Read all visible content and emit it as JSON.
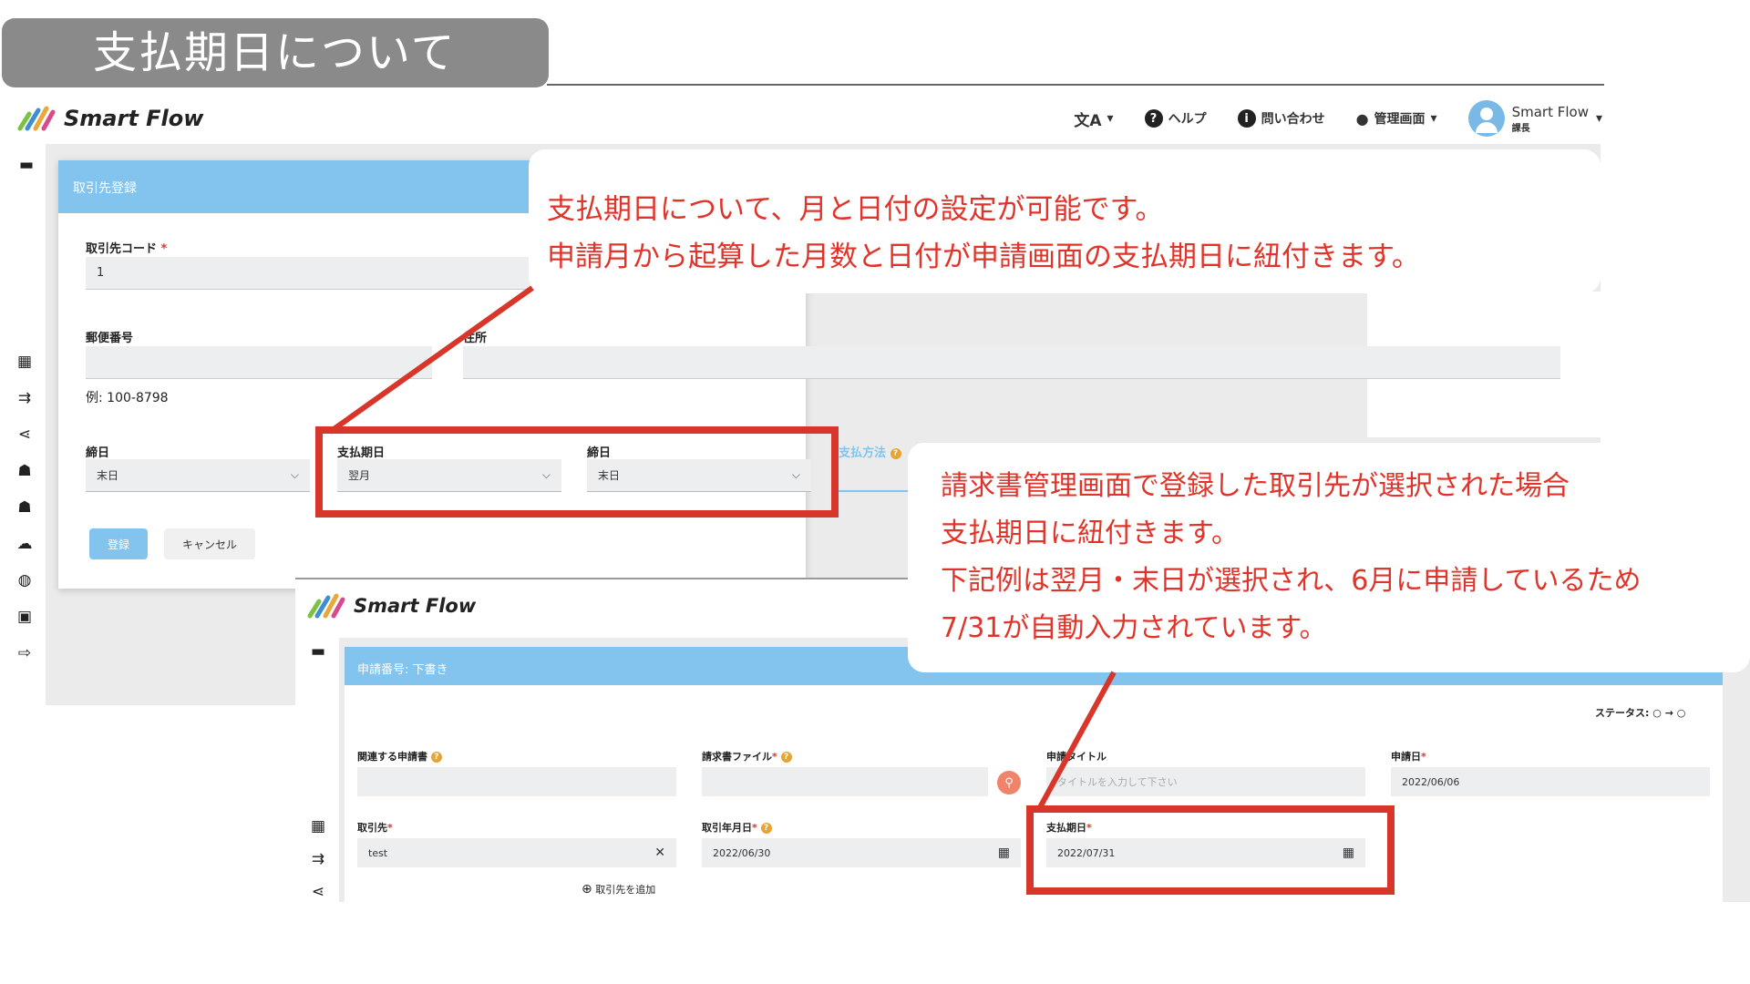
{
  "slide": {
    "title": "支払期日について"
  },
  "app": {
    "logo_text": "Smart Flow",
    "nav": {
      "translate": "文A",
      "help": "ヘルプ",
      "contact": "問い合わせ",
      "admin": "管理画面"
    },
    "user": {
      "name": "Smart Flow",
      "role": "課長"
    }
  },
  "form1": {
    "header": "取引先登録",
    "code_label": "取引先コード",
    "required_mark": "*",
    "code_value": "1",
    "postal_label": "郵便番号",
    "postal_hint": "例: 100-8798",
    "address_label": "住所",
    "closing_label": "締日",
    "closing_value": "末日",
    "pay_due_label": "支払期日",
    "pay_due_month": "翌月",
    "pay_due_day_label": "締日",
    "pay_due_day_value": "末日",
    "pay_method_label": "支払方法",
    "register_button": "登録",
    "cancel_button": "キャンセル"
  },
  "callout1": {
    "line1": "支払期日について、月と日付の設定が可能です。",
    "line2": "申請月から起算した月数と日付が申請画面の支払期日に紐付きます。"
  },
  "callout2": {
    "line1": "請求書管理画面で登録した取引先が選択された場合",
    "line2": "支払期日に紐付きます。",
    "line3": "下記例は翌月・末日が選択され、6月に申請しているため",
    "line4": "7/31が自動入力されています。"
  },
  "form2": {
    "header": "申請番号: 下書き",
    "status_label": "ステータス:",
    "related_label": "関連する申請書",
    "invoice_file_label": "請求書ファイル",
    "title_label": "申請タイトル",
    "title_placeholder": "タイトルを入力して下さい",
    "apply_date_label": "申請日",
    "apply_date_value": "2022/06/06",
    "vendor_label": "取引先",
    "vendor_value": "test",
    "invoice_date_label": "取引年月日",
    "invoice_date_value": "2022/06/30",
    "due_label": "支払期日",
    "due_value": "2022/07/31",
    "add_vendor": "取引先を追加",
    "required_mark": "*"
  },
  "colors": {
    "accent": "#82c4ee",
    "highlight": "#d9362b",
    "callout_text": "#e0342a"
  }
}
